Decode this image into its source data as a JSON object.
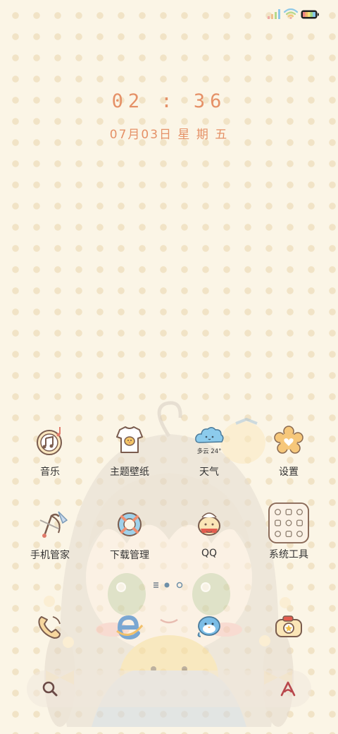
{
  "status_bar": {
    "icons": [
      "signal-icon",
      "wifi-icon",
      "battery-icon"
    ]
  },
  "lockclock": {
    "time": "02 : 36",
    "date": "07月03日  星 期 五"
  },
  "apps": [
    {
      "label": "音乐",
      "icon": "music-icon"
    },
    {
      "label": "主题壁纸",
      "icon": "theme-wallpaper-icon"
    },
    {
      "label": "天气",
      "icon": "weather-icon",
      "weather_text": "多云 24°"
    },
    {
      "label": "设置",
      "icon": "settings-icon"
    },
    {
      "label": "手机管家",
      "icon": "phone-manager-icon"
    },
    {
      "label": "下载管理",
      "icon": "download-manager-icon"
    },
    {
      "label": "QQ",
      "icon": "qq-icon"
    },
    {
      "label": "系统工具",
      "icon": "system-tools-folder-icon"
    }
  ],
  "dock_apps": [
    {
      "icon": "phone-icon"
    },
    {
      "icon": "browser-icon"
    },
    {
      "icon": "messages-icon"
    },
    {
      "icon": "camera-icon"
    }
  ],
  "page_indicator": {
    "pages": 3,
    "current": 1
  },
  "colors": {
    "accent": "#e59167",
    "background": "#fbf5e6",
    "dots": "#f1e3c6"
  }
}
